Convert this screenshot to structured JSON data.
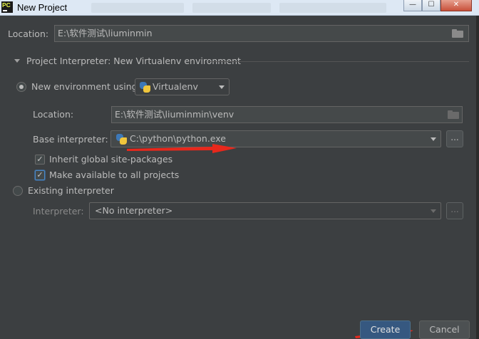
{
  "window": {
    "title": "New Project",
    "app_icon_text": "PC",
    "minimize_glyph": "—",
    "maximize_glyph": "☐",
    "close_glyph": "✕"
  },
  "location": {
    "label": "Location:",
    "value": "E:\\软件测试\\liuminmin"
  },
  "interpreter_section": {
    "title": "Project Interpreter: New Virtualenv environment",
    "new_env_label": "New environment using",
    "new_env_selected": true,
    "env_tool": "Virtualenv",
    "venv_location_label": "Location:",
    "venv_location_value": "E:\\软件测试\\liuminmin\\venv",
    "base_interpreter_label": "Base interpreter:",
    "base_interpreter_value": "C:\\python\\python.exe",
    "inherit_label": "Inherit global site-packages",
    "inherit_checked": true,
    "make_available_label": "Make available to all projects",
    "make_available_checked": true,
    "existing_label": "Existing interpreter",
    "existing_selected": false,
    "interpreter_label": "Interpreter:",
    "interpreter_value": "<No interpreter>",
    "browse_label": "..."
  },
  "buttons": {
    "create": "Create",
    "cancel": "Cancel"
  },
  "colors": {
    "background": "#3c3f41",
    "text": "#bbbbbb",
    "primary_button": "#365880",
    "annotation_arrow": "#e8281c"
  },
  "icons": [
    "app-icon",
    "folder-icon",
    "python-icon",
    "chevron-down-icon",
    "check-icon",
    "radio-icon"
  ]
}
